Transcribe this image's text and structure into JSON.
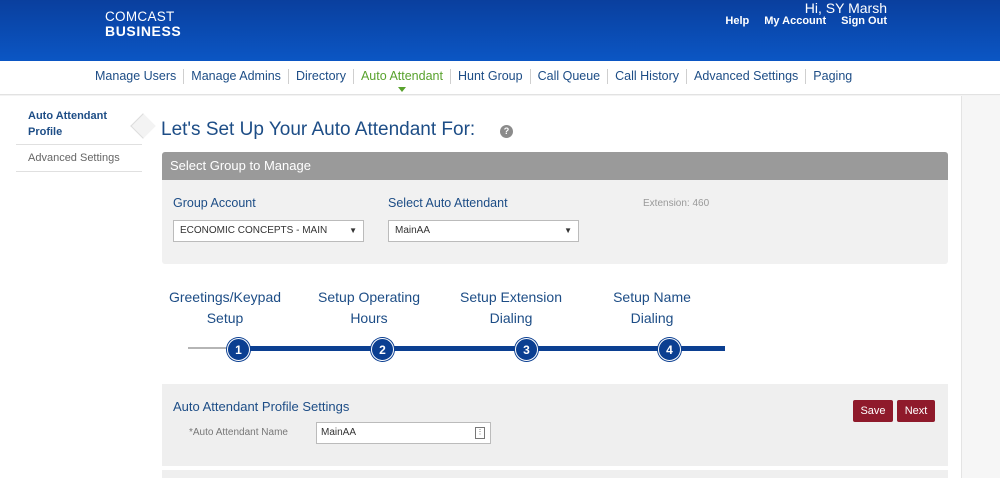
{
  "header": {
    "logo_line1": "COMCAST",
    "logo_line2": "BUSINESS",
    "greeting": "Hi, SY Marsh",
    "links": [
      "Help",
      "My Account",
      "Sign Out"
    ]
  },
  "nav": {
    "items": [
      "Manage Users",
      "Manage Admins",
      "Directory",
      "Auto Attendant",
      "Hunt Group",
      "Call Queue",
      "Call History",
      "Advanced Settings",
      "Paging"
    ],
    "active": "Auto Attendant"
  },
  "sidebar": {
    "items": [
      {
        "label": "Auto Attendant Profile",
        "active": true
      },
      {
        "label": "Advanced Settings",
        "active": false
      }
    ]
  },
  "main": {
    "title": "Let's Set Up Your Auto Attendant For:",
    "help_icon": "question-circle-icon",
    "group_panel": {
      "header": "Select Group to Manage",
      "group_account_label": "Group Account",
      "group_account_value": "ECONOMIC CONCEPTS - MAIN",
      "auto_attendant_label": "Select Auto Attendant",
      "auto_attendant_value": "MainAA",
      "extension_text": "Extension: 460"
    },
    "steps": [
      {
        "line1": "Greetings/Keypad",
        "line2": "Setup",
        "number": "1"
      },
      {
        "line1": "Setup Operating",
        "line2": "Hours",
        "number": "2"
      },
      {
        "line1": "Setup Extension",
        "line2": "Dialing",
        "number": "3"
      },
      {
        "line1": "Setup Name",
        "line2": "Dialing",
        "number": "4"
      }
    ],
    "profile_settings": {
      "title": "Auto Attendant Profile Settings",
      "name_label": "*Auto Attendant Name",
      "name_value": "MainAA",
      "save_label": "Save",
      "next_label": "Next"
    }
  },
  "colors": {
    "header_blue": "#0b56c4",
    "link_blue": "#1d4d86",
    "active_green": "#58a22d",
    "step_blue": "#0b3f91",
    "button_red": "#8f1a2b"
  }
}
